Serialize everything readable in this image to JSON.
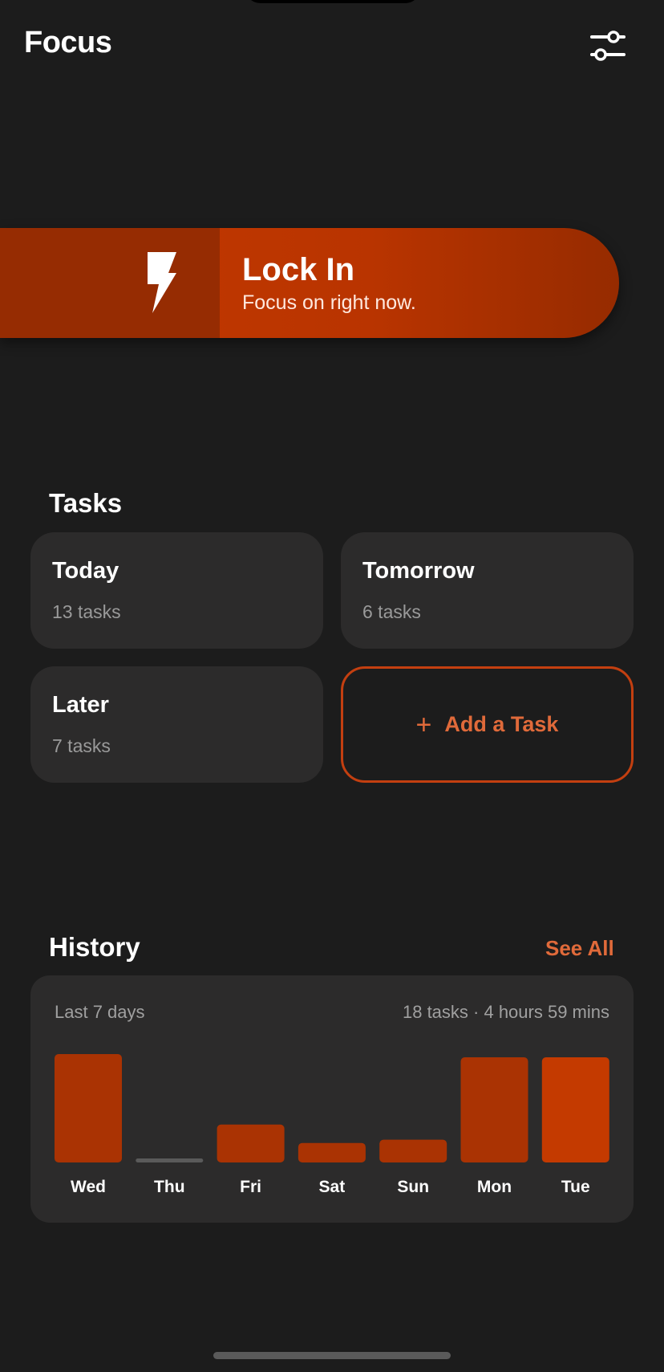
{
  "header": {
    "title": "Focus",
    "settings_icon": "sliders-icon"
  },
  "lock_in": {
    "title": "Lock In",
    "subtitle": "Focus on right now.",
    "icon": "lightning-bolt-icon"
  },
  "tasks": {
    "title": "Tasks",
    "cards": [
      {
        "label": "Today",
        "count": "13 tasks"
      },
      {
        "label": "Tomorrow",
        "count": "6 tasks"
      },
      {
        "label": "Later",
        "count": "7 tasks"
      }
    ],
    "add_label": "Add a Task"
  },
  "history": {
    "title": "History",
    "see_all": "See All",
    "range": "Last 7 days",
    "summary": "18 tasks · 4 hours 59 mins"
  },
  "colors": {
    "background": "#1c1c1c",
    "card": "#2c2b2b",
    "accent": "#c43a00",
    "accent_text": "#e06a3a",
    "bar": "#aa3303",
    "bar_highlight": "#c43a00",
    "bar_empty": "#5a5a5a"
  },
  "chart_data": {
    "type": "bar",
    "categories": [
      "Wed",
      "Thu",
      "Fri",
      "Sat",
      "Sun",
      "Mon",
      "Tue"
    ],
    "values": [
      1.0,
      0.0,
      0.35,
      0.18,
      0.21,
      0.97,
      0.97
    ],
    "highlight_index": 6
  }
}
